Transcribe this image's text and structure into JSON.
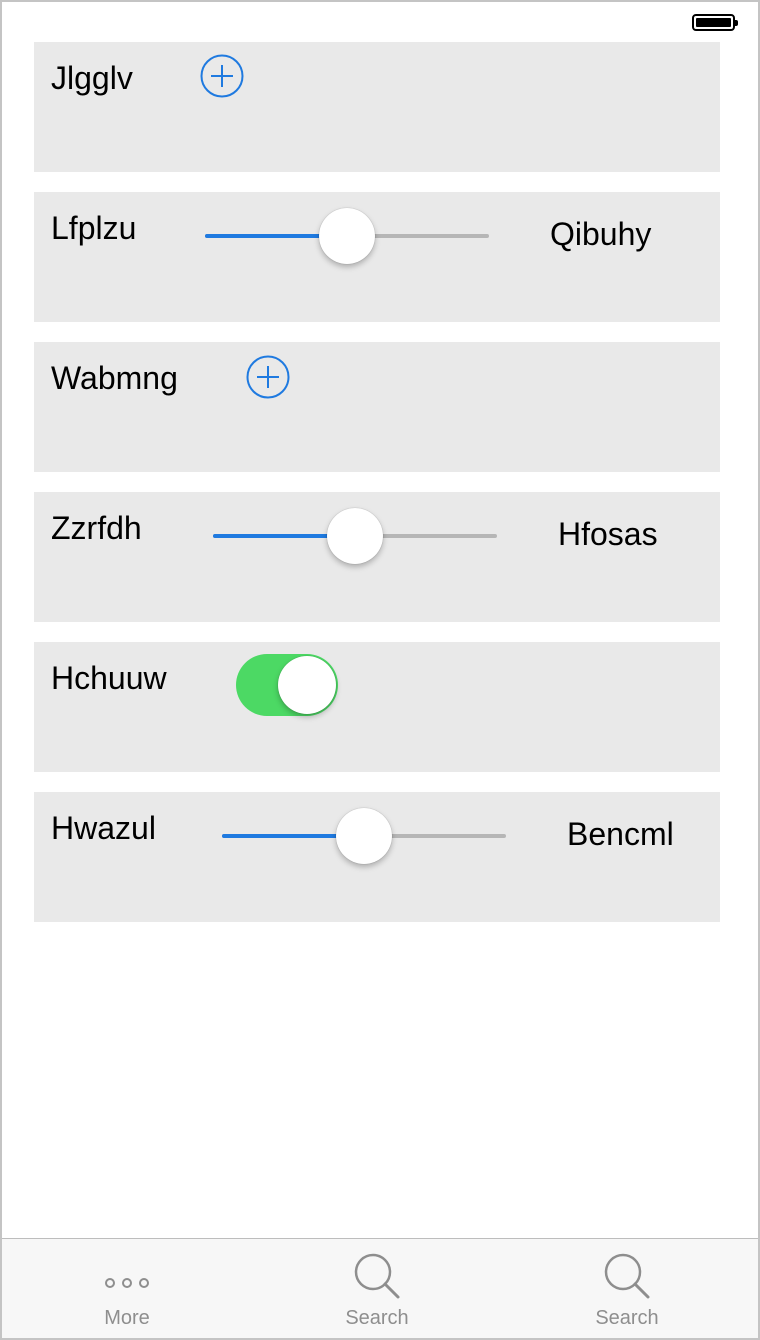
{
  "status_bar": {
    "battery_icon": "battery-full-icon"
  },
  "rows": [
    {
      "kind": "add",
      "label": "Jlgglv",
      "icon": "plus-circle-icon"
    },
    {
      "kind": "slider",
      "label": "Lfplzu",
      "right_label": "Qibuhy",
      "value": 0.5
    },
    {
      "kind": "add",
      "label": "Wabmng",
      "icon": "plus-circle-icon"
    },
    {
      "kind": "slider",
      "label": "Zzrfdh",
      "right_label": "Hfosas",
      "value": 0.5
    },
    {
      "kind": "toggle",
      "label": "Hchuuw",
      "on": true
    },
    {
      "kind": "slider",
      "label": "Hwazul",
      "right_label": "Bencml",
      "value": 0.5
    }
  ],
  "tab_bar": {
    "items": [
      {
        "label": "More",
        "icon": "more-dots-icon"
      },
      {
        "label": "Search",
        "icon": "search-icon"
      },
      {
        "label": "Search",
        "icon": "search-icon"
      }
    ]
  },
  "colors": {
    "accent": "#1f7ae0",
    "toggle_on": "#4cd964",
    "row_background": "#e9e9e9",
    "tab_label": "#8e8e8e"
  }
}
